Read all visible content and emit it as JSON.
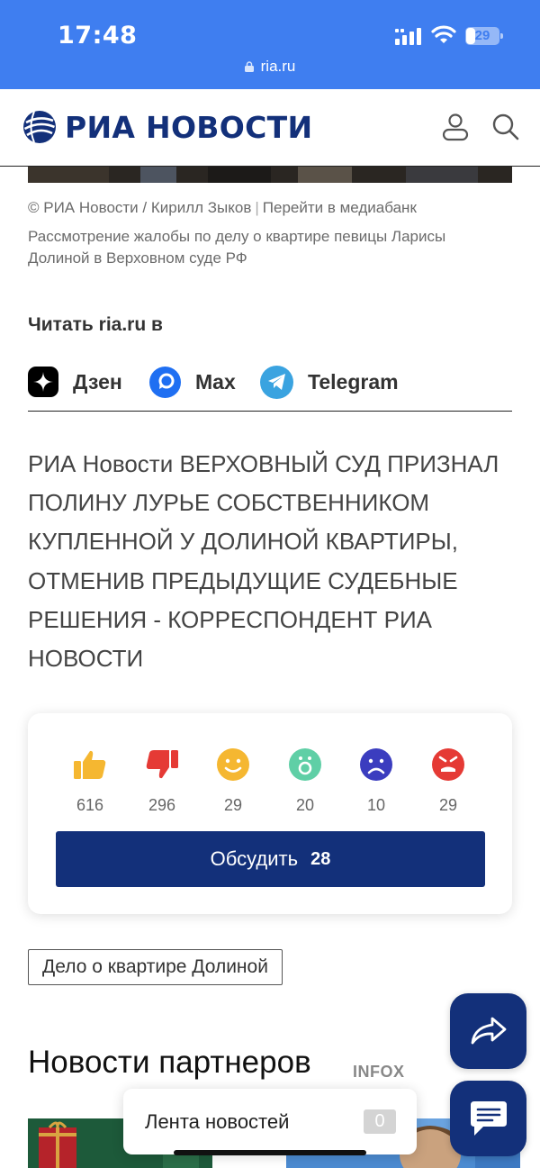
{
  "status_bar": {
    "time": "17:48",
    "battery": "29",
    "battery_fraction": 0.29,
    "url": "ria.ru"
  },
  "header": {
    "logo_text": "РИА НОВОСТИ",
    "icons": [
      "user-icon",
      "search-icon"
    ]
  },
  "photo": {
    "credit": "© РИА Новости / Кирилл Зыков",
    "mediabank_link": "Перейти в медиабанк",
    "caption": "Рассмотрение жалобы по делу о квартире певицы Ларисы Долиной в Верховном суде РФ"
  },
  "read_in": {
    "title": "Читать ria.ru в",
    "channels": [
      {
        "label": "Дзен",
        "icon": "dzen-icon",
        "color": "#000000"
      },
      {
        "label": "Max",
        "icon": "max-icon",
        "color": "#1f6ff2"
      },
      {
        "label": "Telegram",
        "icon": "telegram-icon",
        "color": "#3aa3e0"
      }
    ]
  },
  "lead_text": "РИА Новости ВЕРХОВНЫЙ СУД ПРИЗНАЛ ПОЛИНУ ЛУРЬЕ СОБСТВЕННИКОМ КУПЛЕННОЙ У ДОЛИНОЙ КВАРТИРЫ, ОТМЕНИВ ПРЕДЫДУЩИЕ СУДЕБНЫЕ РЕШЕНИЯ - КОРРЕСПОНДЕНТ РИА НОВОСТИ",
  "reactions": {
    "items": [
      {
        "icon": "thumbs-up-icon",
        "count": "616",
        "color": "#f5b731"
      },
      {
        "icon": "thumbs-down-icon",
        "count": "296",
        "color": "#e53a35"
      },
      {
        "icon": "smile-icon",
        "count": "29",
        "color": "#f5b731"
      },
      {
        "icon": "surprised-icon",
        "count": "20",
        "color": "#5fcfa6"
      },
      {
        "icon": "sad-icon",
        "count": "10",
        "color": "#3b3dbf"
      },
      {
        "icon": "angry-icon",
        "count": "29",
        "color": "#e53a35"
      }
    ],
    "discuss_label": "Обсудить",
    "discuss_count": "28"
  },
  "tag": "Дело о квартире Долиной",
  "partners": {
    "title": "Новости партнеров",
    "source": "INFOX"
  },
  "news_feed": {
    "label": "Лента новостей",
    "count": "0"
  },
  "colors": {
    "brand": "#13307a",
    "browser_bar": "#3f7ef0"
  },
  "fabs": [
    "share-icon",
    "chat-icon"
  ]
}
